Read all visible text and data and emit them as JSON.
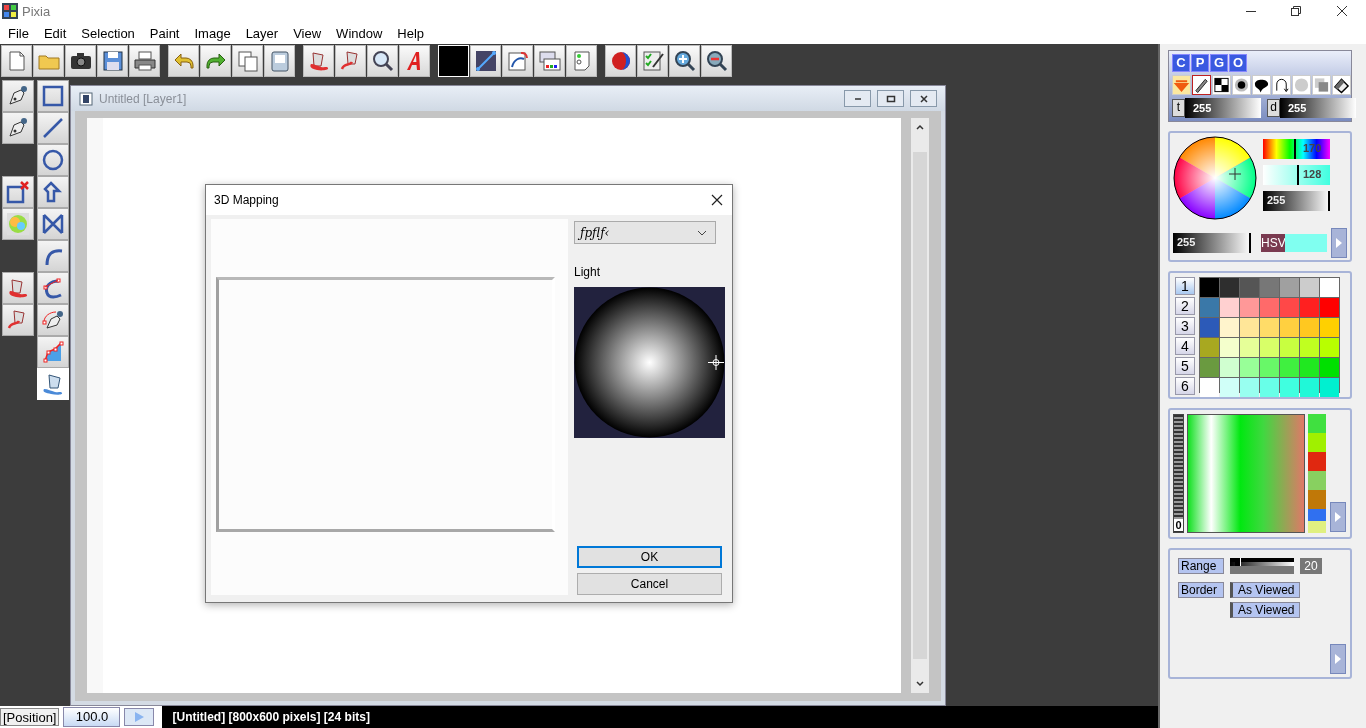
{
  "window": {
    "title": "Pixia"
  },
  "menu": [
    "File",
    "Edit",
    "Selection",
    "Paint",
    "Image",
    "Layer",
    "View",
    "Window",
    "Help"
  ],
  "toolbar": {
    "current_swatch": {
      "color": "#000000"
    }
  },
  "tools": [
    {
      "selected": false
    },
    {
      "selected": false
    },
    {
      "selected": false
    },
    {
      "selected": false
    },
    {
      "selected": false
    },
    {
      "selected": false
    },
    {
      "selected": false
    },
    {
      "selected": false
    },
    {
      "selected": false
    },
    {
      "selected": false
    },
    {
      "selected": false
    },
    {
      "selected": false
    },
    {
      "selected": false
    },
    {
      "selected": false
    },
    {
      "selected": false
    },
    {
      "selected": true
    }
  ],
  "document": {
    "title": "Untitled [Layer1]"
  },
  "dialog": {
    "title": "3D Mapping",
    "dropdown": {
      "value": "ƒpƒlƒ‹"
    },
    "light_label": "Light",
    "buttons": [
      {
        "label": "OK",
        "kind": "default"
      },
      {
        "label": "Cancel",
        "kind": "normal"
      }
    ]
  },
  "right_panel": {
    "tabs": [
      "C",
      "P",
      "G",
      "O"
    ],
    "brush_modes": [
      {
        "selected": false
      },
      {
        "selected": true
      },
      {
        "selected": false
      },
      {
        "selected": false
      },
      {
        "selected": false
      },
      {
        "selected": false
      },
      {
        "selected": false
      },
      {
        "selected": false
      },
      {
        "selected": false
      }
    ],
    "brush_sliders": [
      {
        "label": "t",
        "value": "255",
        "level": 1
      },
      {
        "label": "d",
        "value": "255",
        "level": 1
      }
    ],
    "color": {
      "hue": {
        "value": "170",
        "level": 0.47
      },
      "saturation": {
        "value": "128",
        "level": 0.5
      },
      "brightness": {
        "value": "255",
        "level": 1
      },
      "opacity": {
        "value": "255",
        "level": 1
      },
      "mode": "HSV",
      "current_swatch": {
        "color": "#80fff0"
      }
    },
    "palette": {
      "pages": [
        {
          "label": "1",
          "selected": true
        },
        {
          "label": "2",
          "selected": false
        },
        {
          "label": "3",
          "selected": false
        },
        {
          "label": "4",
          "selected": false
        },
        {
          "label": "5",
          "selected": false
        },
        {
          "label": "6",
          "selected": false
        }
      ],
      "rows": [
        {
          "swatches": [
            {
              "color": "#2e2e2e"
            },
            {
              "color": "#555555"
            },
            {
              "color": "#777777"
            },
            {
              "color": "#a0a0a0"
            },
            {
              "color": "#cccccc"
            },
            {
              "color": "#ffffff"
            }
          ]
        },
        {
          "swatches": [
            {
              "color": "#ffd0d0"
            },
            {
              "color": "#ff9898"
            },
            {
              "color": "#ff6a6a"
            },
            {
              "color": "#ff4848"
            },
            {
              "color": "#ff2020"
            },
            {
              "color": "#ff0000"
            }
          ]
        },
        {
          "swatches": [
            {
              "color": "#fff4cc"
            },
            {
              "color": "#ffe698"
            },
            {
              "color": "#ffdc68"
            },
            {
              "color": "#ffd040"
            },
            {
              "color": "#ffc820"
            },
            {
              "color": "#ffd000"
            }
          ]
        },
        {
          "swatches": [
            {
              "color": "#f4ffcc"
            },
            {
              "color": "#e6ff98"
            },
            {
              "color": "#d8ff68"
            },
            {
              "color": "#c8ff40"
            },
            {
              "color": "#c0ff20"
            },
            {
              "color": "#b8ff00"
            }
          ]
        },
        {
          "swatches": [
            {
              "color": "#d0ffd0"
            },
            {
              "color": "#98ff98"
            },
            {
              "color": "#68f868"
            },
            {
              "color": "#40f040"
            },
            {
              "color": "#20e820"
            },
            {
              "color": "#00e000"
            }
          ]
        },
        {
          "swatches": [
            {
              "color": "#d0fff8"
            },
            {
              "color": "#98fff0"
            },
            {
              "color": "#68ffe8"
            },
            {
              "color": "#40ffe0"
            },
            {
              "color": "#20f8d8"
            },
            {
              "color": "#00f0d0"
            }
          ]
        }
      ]
    },
    "gradient": {
      "value": "0"
    },
    "options": {
      "range": {
        "label": "Range",
        "value": "20",
        "level": 0.08
      },
      "border": {
        "label": "Border",
        "options": [
          "As Viewed",
          "As Viewed"
        ]
      }
    }
  },
  "status_bar": {
    "position": "[Position]",
    "zoom": "100.0",
    "info": "[Untitled] [800x600 pixels] [24 bits]"
  }
}
